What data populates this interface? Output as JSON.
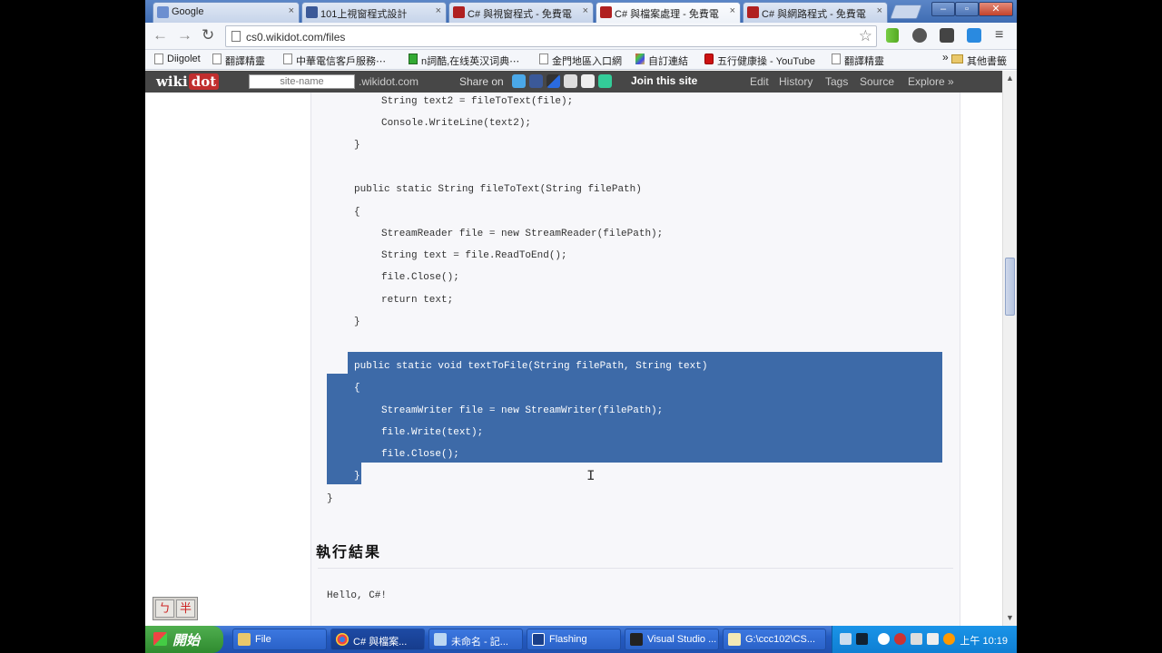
{
  "tabs": [
    {
      "label": "Google",
      "color": "#6c8fd0"
    },
    {
      "label": "101上視窗程式設計",
      "color": "#3b5998"
    },
    {
      "label": "C# 與視窗程式 - 免費電",
      "color": "#b02020"
    },
    {
      "label": "C# 與檔案處理 - 免費電",
      "color": "#b02020"
    },
    {
      "label": "C# 與網路程式 - 免費電",
      "color": "#b02020"
    }
  ],
  "address": {
    "url": "cs0.wikidot.com/files"
  },
  "bookmarks": [
    {
      "label": "Diigolet",
      "icon": "page-icon"
    },
    {
      "label": "翻譯精靈",
      "icon": "page-icon"
    },
    {
      "label": "中華電信客戶服務⋯",
      "icon": "page-icon"
    },
    {
      "label": "n詞酷,在线英汉词典⋯",
      "icon": "page-icon"
    },
    {
      "label": "金門地區入口網",
      "icon": "page-icon"
    },
    {
      "label": "自訂連結",
      "icon": "page-icon"
    },
    {
      "label": "五行健康操 - YouTube",
      "icon": "youtube-icon"
    },
    {
      "label": "翻譯精靈",
      "icon": "page-icon"
    },
    {
      "label": "其他書籤",
      "icon": "folder-icon"
    }
  ],
  "wikibar": {
    "logo_text": "wiki",
    "logo_dot": "dot",
    "site_name_placeholder": "site-name",
    "domain": ".wikidot.com",
    "share_label": "Share on",
    "join": "Join this site",
    "links": [
      "Edit",
      "History",
      "Tags",
      "Source",
      "Explore »"
    ]
  },
  "code_lines": [
    "String text2 = fileToText(file);",
    "Console.WriteLine(text2);",
    "}",
    "public static String fileToText(String filePath)",
    "{",
    "StreamReader file = new StreamReader(filePath);",
    "String text = file.ReadToEnd();",
    "file.Close();",
    "return text;",
    "}",
    "public static void textToFile(String filePath, String text)",
    "{",
    "StreamWriter file = new StreamWriter(filePath);",
    "file.Write(text);",
    "file.Close();",
    "}",
    "}"
  ],
  "section_title": "執行結果",
  "output_text": "Hello, C#!",
  "ime": {
    "key1": "ㄅ",
    "key2": "半"
  },
  "taskbar": {
    "start_label": "開始",
    "tasks": [
      "File",
      "C# 與檔案...",
      "未命名 - 記...",
      "Flashing",
      "Visual Studio ...",
      "G:\\ccc102\\CS..."
    ],
    "clock": "上午 10:19"
  },
  "colors": {
    "selection": "#3d6aa8",
    "wikibar": "#474747",
    "taskbar": "#245bc2"
  }
}
